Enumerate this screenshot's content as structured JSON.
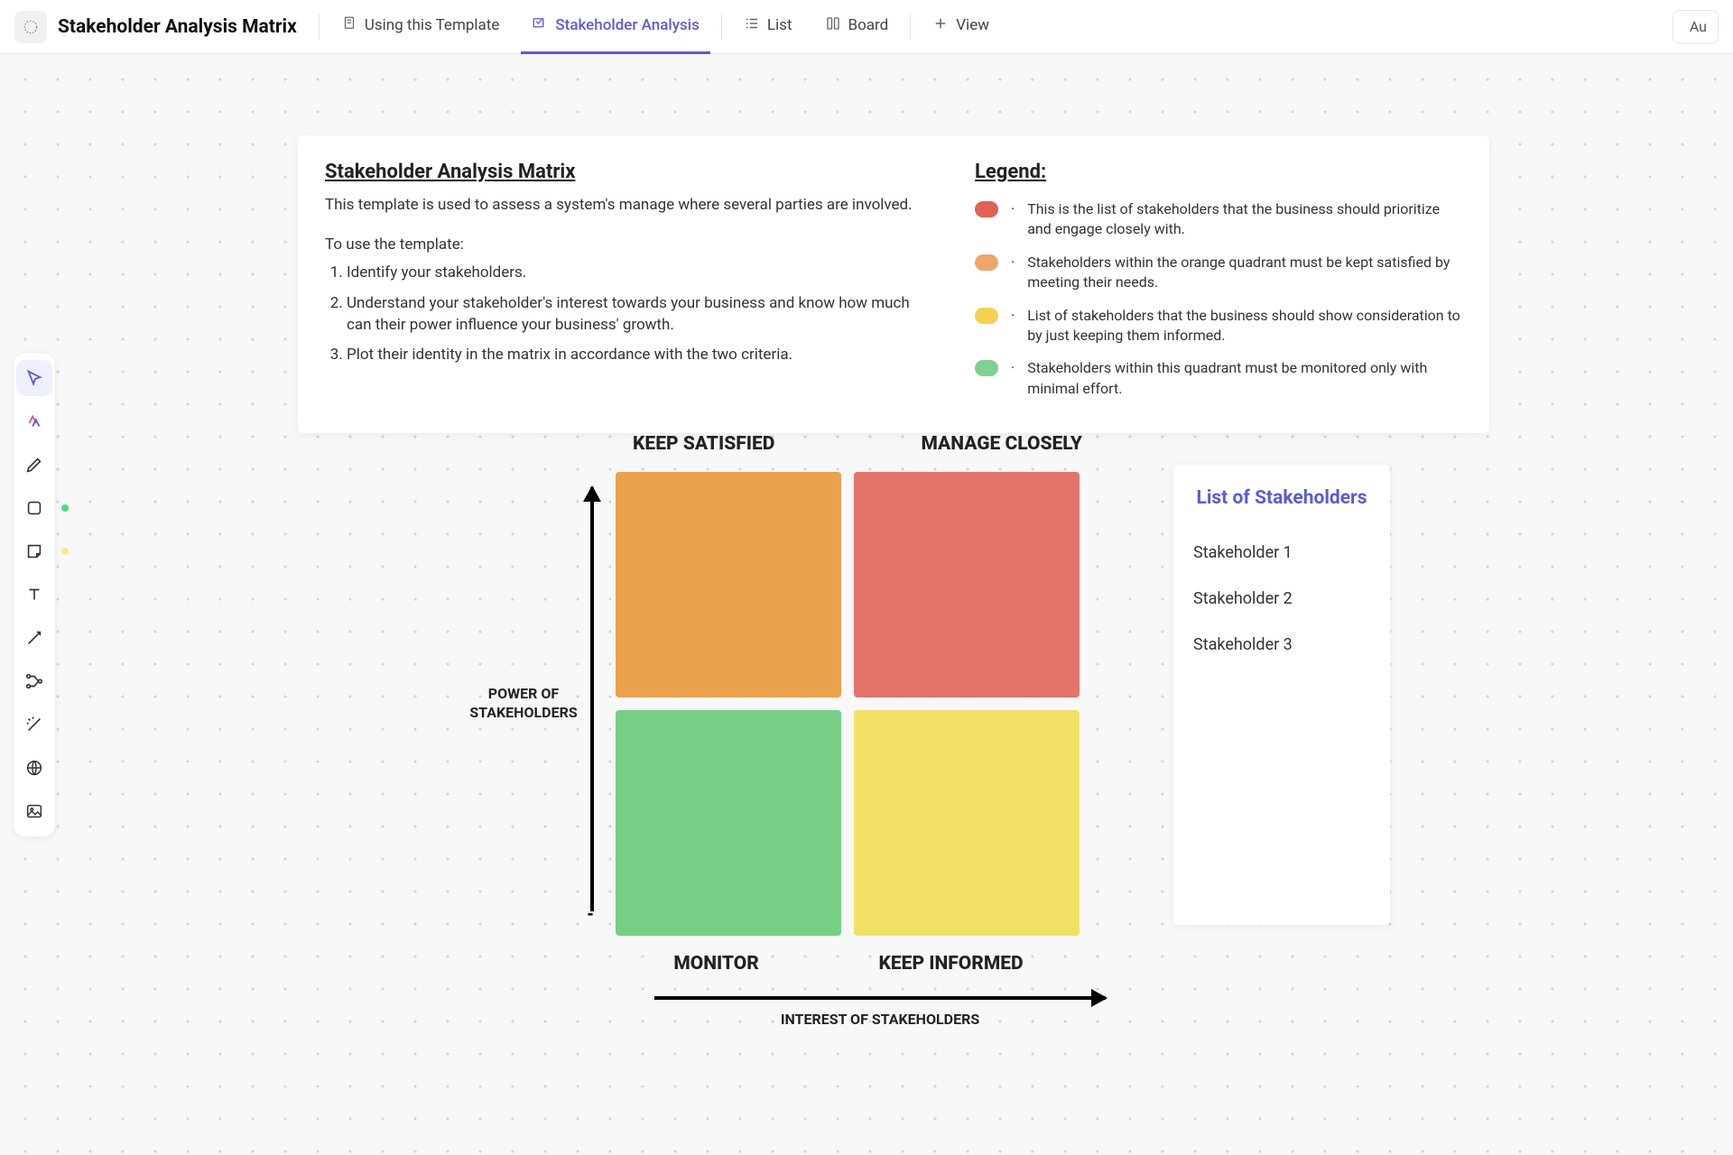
{
  "doc": {
    "title": "Stakeholder Analysis Matrix"
  },
  "tabs": {
    "template": "Using this Template",
    "analysis": "Stakeholder Analysis",
    "list": "List",
    "board": "Board",
    "addView": "View"
  },
  "ai_button": "Au",
  "toolbar_dots": {
    "pen": "#5b5bd6",
    "shape": "#4ade80",
    "sticky": "#fde68a"
  },
  "instructions": {
    "title": "Stakeholder Analysis Matrix",
    "description": "This template is used to assess a system's manage where several parties are involved.",
    "subtitle": "To use the template:",
    "steps": [
      "Identify your stakeholders.",
      "Understand your stakeholder's interest towards your business and know how much can their power influence your business' growth.",
      "Plot their identity in the matrix in accordance with the two criteria."
    ]
  },
  "legend": {
    "title": "Legend:",
    "items": [
      {
        "color": "#e06257",
        "text": "This is the list of stakeholders that the business should prioritize and engage closely with."
      },
      {
        "color": "#efa66b",
        "text": "Stakeholders within the orange quadrant must be kept satisfied by meeting their needs."
      },
      {
        "color": "#f3d152",
        "text": "List of stakeholders that the business should show consideration to by just keeping them informed."
      },
      {
        "color": "#7fd18f",
        "text": "Stakeholders within this quadrant must be monitored only with minimal effort."
      }
    ]
  },
  "matrix": {
    "top_left_label": "KEEP SATISFIED",
    "top_right_label": "MANAGE CLOSELY",
    "bottom_left_label": "MONITOR",
    "bottom_right_label": "KEEP INFORMED",
    "y_axis": "POWER OF STAKEHOLDERS",
    "x_axis": "INTEREST OF STAKEHOLDERS",
    "colors": {
      "keep_satisfied": "#eaa24e",
      "manage_closely": "#e3746a",
      "monitor": "#77cf86",
      "keep_informed": "#f1df66"
    }
  },
  "stakeholders": {
    "title": "List of Stakeholders",
    "items": [
      "Stakeholder 1",
      "Stakeholder 2",
      "Stakeholder 3"
    ]
  }
}
